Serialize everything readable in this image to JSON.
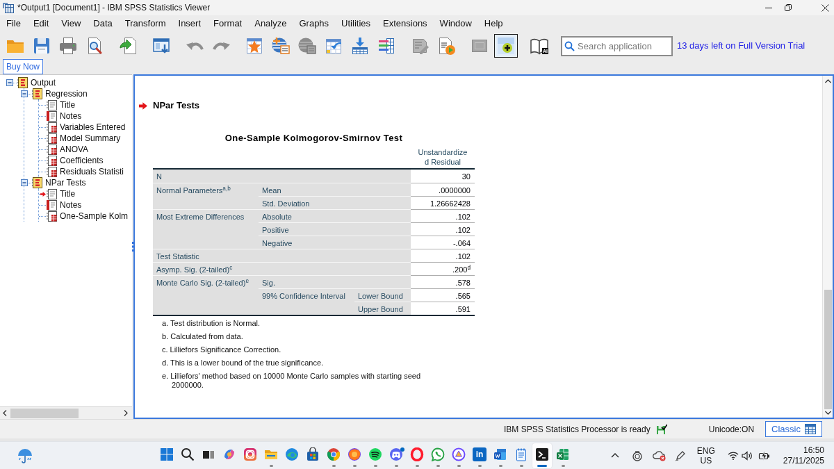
{
  "window": {
    "title": "*Output1 [Document1] - IBM SPSS Statistics Viewer"
  },
  "menu": [
    "File",
    "Edit",
    "View",
    "Data",
    "Transform",
    "Insert",
    "Format",
    "Analyze",
    "Graphs",
    "Utilities",
    "Extensions",
    "Window",
    "Help"
  ],
  "toolbar": {
    "groups": [
      [
        {
          "kind": "folder",
          "disabled": false,
          "pressed": false
        },
        {
          "kind": "floppy",
          "disabled": false,
          "pressed": false
        },
        {
          "kind": "printer",
          "disabled": false,
          "pressed": false
        },
        {
          "kind": "preview",
          "disabled": false,
          "pressed": false
        }
      ],
      [
        {
          "kind": "export",
          "disabled": false,
          "pressed": false
        }
      ],
      [
        {
          "kind": "designate",
          "disabled": false,
          "pressed": false
        }
      ],
      [
        {
          "kind": "undo",
          "disabled": true,
          "pressed": false
        },
        {
          "kind": "redo",
          "disabled": true,
          "pressed": false
        }
      ],
      [
        {
          "kind": "star",
          "disabled": false,
          "pressed": false
        },
        {
          "kind": "globe",
          "disabled": false,
          "pressed": false
        },
        {
          "kind": "globe",
          "disabled": true,
          "pressed": false
        },
        {
          "kind": "variables",
          "disabled": false,
          "pressed": false
        },
        {
          "kind": "insert",
          "disabled": false,
          "pressed": false
        },
        {
          "kind": "bars",
          "disabled": false,
          "pressed": false
        }
      ],
      [
        {
          "kind": "pencil",
          "disabled": true,
          "pressed": false
        },
        {
          "kind": "play",
          "disabled": false,
          "pressed": false
        }
      ],
      [
        {
          "kind": "frame",
          "disabled": true,
          "pressed": false
        },
        {
          "kind": "plus",
          "disabled": false,
          "pressed": true
        }
      ],
      [
        {
          "kind": "book",
          "label": "AI",
          "disabled": false,
          "pressed": false
        }
      ]
    ],
    "search": {
      "placeholder": "Search application"
    },
    "trial_notice": "13 days left on Full Version Trial"
  },
  "buy_button": {
    "label": "Buy Now"
  },
  "outline": [
    {
      "label": "Output",
      "kind": "book",
      "expanded": true,
      "current": false,
      "children": [
        {
          "label": "Regression",
          "kind": "book",
          "expanded": true,
          "current": false,
          "children": [
            {
              "label": "Title",
              "kind": "title",
              "current": false
            },
            {
              "label": "Notes",
              "kind": "notes",
              "current": false
            },
            {
              "label": "Variables Entered",
              "kind": "table",
              "current": false
            },
            {
              "label": "Model Summary",
              "kind": "table",
              "current": false
            },
            {
              "label": "ANOVA",
              "kind": "table",
              "current": false
            },
            {
              "label": "Coefficients",
              "kind": "table",
              "current": false
            },
            {
              "label": "Residuals Statisti",
              "kind": "table",
              "current": false
            }
          ]
        },
        {
          "label": "NPar Tests",
          "kind": "book",
          "expanded": true,
          "current": false,
          "children": [
            {
              "label": "Title",
              "kind": "title",
              "current": true
            },
            {
              "label": "Notes",
              "kind": "notes",
              "current": false
            },
            {
              "label": "One-Sample Kolm",
              "kind": "table",
              "current": false
            }
          ]
        }
      ]
    }
  ],
  "viewer": {
    "heading": {
      "title": "NPar Tests",
      "current": true
    },
    "table": {
      "title": "One-Sample Kolmogorov-Smirnov Test",
      "column_header": [
        "Unstandardize",
        "d Residual"
      ],
      "rows": [
        {
          "label": "N",
          "value": "30"
        },
        {
          "label": "Normal Parameters$^{a,b}$",
          "children": [
            {
              "label": "Mean",
              "value": ".0000000"
            },
            {
              "label": "Std. Deviation",
              "value": "1.26662428"
            }
          ]
        },
        {
          "label": "Most Extreme Differences",
          "children": [
            {
              "label": "Absolute",
              "value": ".102"
            },
            {
              "label": "Positive",
              "value": ".102"
            },
            {
              "label": "Negative",
              "value": "-.064"
            }
          ]
        },
        {
          "label": "Test Statistic",
          "value": ".102"
        },
        {
          "label": "Asymp. Sig. (2-tailed)$^{c}$",
          "value": ".200$^{d}$"
        },
        {
          "label": "Monte Carlo Sig. (2-tailed)$^{e}$",
          "children": [
            {
              "label": "Sig.",
              "value": ".578"
            },
            {
              "label": "99% Confidence Interval",
              "children": [
                {
                  "label": "Lower Bound",
                  "value": ".565"
                },
                {
                  "label": "Upper Bound",
                  "value": ".591"
                }
              ]
            }
          ]
        }
      ]
    },
    "footnotes": [
      "a. Test distribution is Normal.",
      "b. Calculated from data.",
      "c. Lilliefors Significance Correction.",
      "d. This is a lower bound of the true significance.",
      "e. Lilliefors' method based on 10000 Monte Carlo samples with starting seed 2000000."
    ]
  },
  "status_bar": {
    "message": "IBM SPSS Statistics Processor is ready",
    "encoding": "Unicode:ON",
    "mode_button": "Classic"
  },
  "taskbar": {
    "apps": [
      {
        "kind": "start",
        "running": false,
        "active": false,
        "notification": false
      },
      {
        "kind": "search",
        "running": false,
        "active": false,
        "notification": false
      },
      {
        "kind": "taskview",
        "running": false,
        "active": false,
        "notification": false
      },
      {
        "kind": "swirl",
        "running": false,
        "active": false,
        "notification": false
      },
      {
        "kind": "camera",
        "running": false,
        "active": false,
        "notification": false
      },
      {
        "kind": "folder",
        "running": true,
        "active": false,
        "notification": false
      },
      {
        "kind": "wave",
        "running": false,
        "active": false,
        "notification": false
      },
      {
        "kind": "bag",
        "running": false,
        "active": false,
        "notification": false
      },
      {
        "kind": "segments",
        "running": true,
        "active": false,
        "notification": false
      },
      {
        "kind": "flame",
        "running": true,
        "active": false,
        "notification": false
      },
      {
        "kind": "arcs",
        "running": true,
        "active": false,
        "notification": false
      },
      {
        "kind": "controller",
        "running": true,
        "active": false,
        "notification": true
      },
      {
        "kind": "ring",
        "running": true,
        "active": false,
        "notification": false
      },
      {
        "kind": "chat",
        "running": true,
        "active": false,
        "notification": false
      },
      {
        "kind": "shield",
        "running": true,
        "active": false,
        "notification": false
      },
      {
        "kind": "logo",
        "label": "in",
        "running": true,
        "active": false,
        "notification": false
      },
      {
        "kind": "document",
        "running": true,
        "active": false,
        "notification": false
      },
      {
        "kind": "notepad",
        "running": true,
        "active": false,
        "notification": false
      },
      {
        "kind": "terminal",
        "running": true,
        "active": true,
        "notification": false
      },
      {
        "kind": "sheet",
        "running": true,
        "active": false,
        "notification": false
      }
    ],
    "tray": {
      "language": "ENG",
      "region": "US",
      "time": "16:50",
      "date": "27/11/2025"
    }
  }
}
